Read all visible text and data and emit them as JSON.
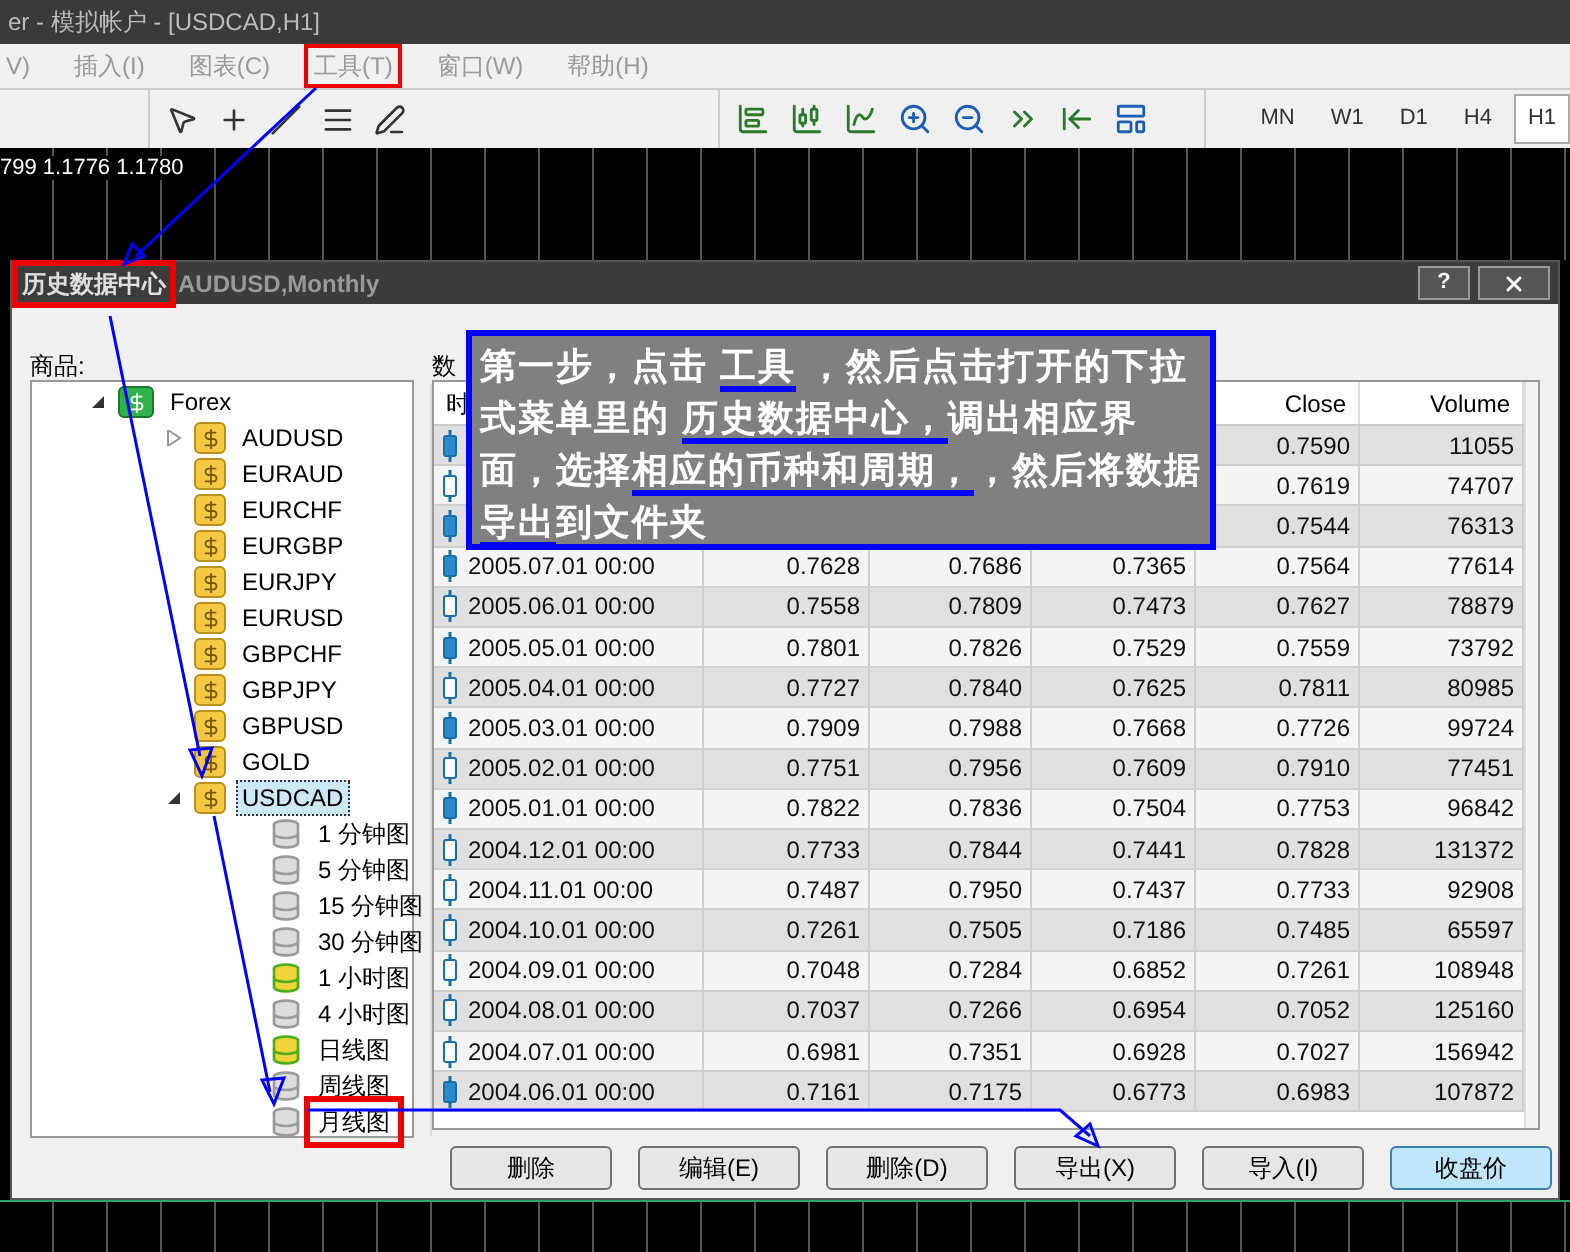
{
  "app_title": "er - 模拟帐户 - [USDCAD,H1]",
  "menu": [
    {
      "label": "V)",
      "highlighted": false
    },
    {
      "label": "插入(I)",
      "highlighted": false
    },
    {
      "label": "图表(C)",
      "highlighted": false
    },
    {
      "label": "工具(T)",
      "highlighted": true
    },
    {
      "label": "窗口(W)",
      "highlighted": false
    },
    {
      "label": "帮助(H)",
      "highlighted": false
    }
  ],
  "timeframes": [
    {
      "label": "MN",
      "selected": false
    },
    {
      "label": "W1",
      "selected": false
    },
    {
      "label": "D1",
      "selected": false
    },
    {
      "label": "H4",
      "selected": false
    },
    {
      "label": "H1",
      "selected": true
    }
  ],
  "chart_strip": "799 1.1776 1.1780",
  "dialog": {
    "title": "历史数据中心",
    "subtitle": "AUDUSD,Monthly",
    "title_highlighted": true,
    "help_button": "?",
    "symbols_label": "商品:",
    "data_label": "数",
    "tree": [
      {
        "label": "Forex",
        "kind": "folder",
        "expanded": true,
        "selected": false,
        "children": [
          {
            "label": "AUDUSD",
            "kind": "symbol",
            "expanded": false,
            "selected": false
          },
          {
            "label": "EURAUD",
            "kind": "symbol",
            "selected": false
          },
          {
            "label": "EURCHF",
            "kind": "symbol",
            "selected": false
          },
          {
            "label": "EURGBP",
            "kind": "symbol",
            "selected": false
          },
          {
            "label": "EURJPY",
            "kind": "symbol",
            "selected": false
          },
          {
            "label": "EURUSD",
            "kind": "symbol",
            "selected": false
          },
          {
            "label": "GBPCHF",
            "kind": "symbol",
            "selected": false
          },
          {
            "label": "GBPJPY",
            "kind": "symbol",
            "selected": false
          },
          {
            "label": "GBPUSD",
            "kind": "symbol",
            "selected": false
          },
          {
            "label": "GOLD",
            "kind": "symbol",
            "selected": false
          },
          {
            "label": "USDCAD",
            "kind": "symbol",
            "expanded": true,
            "selected": true,
            "children": [
              {
                "label": "1 分钟图",
                "kind": "timeframe",
                "has_data": false,
                "selected": false,
                "highlighted": false
              },
              {
                "label": "5 分钟图",
                "kind": "timeframe",
                "has_data": false,
                "selected": false,
                "highlighted": false
              },
              {
                "label": "15 分钟图",
                "kind": "timeframe",
                "has_data": false,
                "selected": false,
                "highlighted": false
              },
              {
                "label": "30 分钟图",
                "kind": "timeframe",
                "has_data": false,
                "selected": false,
                "highlighted": false
              },
              {
                "label": "1 小时图",
                "kind": "timeframe",
                "has_data": true,
                "selected": false,
                "highlighted": false
              },
              {
                "label": "4 小时图",
                "kind": "timeframe",
                "has_data": false,
                "selected": false,
                "highlighted": false
              },
              {
                "label": "日线图",
                "kind": "timeframe",
                "has_data": true,
                "selected": false,
                "highlighted": false
              },
              {
                "label": "周线图",
                "kind": "timeframe",
                "has_data": false,
                "selected": false,
                "highlighted": false
              },
              {
                "label": "月线图",
                "kind": "timeframe",
                "has_data": false,
                "selected": false,
                "highlighted": true
              }
            ]
          }
        ]
      }
    ],
    "table": {
      "columns": [
        "时",
        null,
        null,
        null,
        "Close",
        "Volume"
      ],
      "rows": [
        {
          "filled": true,
          "cells": [
            null,
            null,
            null,
            null,
            "0.7590",
            "11055"
          ]
        },
        {
          "filled": false,
          "cells": [
            null,
            null,
            null,
            null,
            "0.7619",
            "74707"
          ]
        },
        {
          "filled": true,
          "cells": [
            null,
            null,
            null,
            null,
            "0.7544",
            "76313"
          ]
        },
        {
          "filled": true,
          "cells": [
            "2005.07.01 00:00",
            "0.7628",
            "0.7686",
            "0.7365",
            "0.7564",
            "77614"
          ]
        },
        {
          "filled": false,
          "cells": [
            "2005.06.01 00:00",
            "0.7558",
            "0.7809",
            "0.7473",
            "0.7627",
            "78879"
          ]
        },
        {
          "filled": true,
          "cells": [
            "2005.05.01 00:00",
            "0.7801",
            "0.7826",
            "0.7529",
            "0.7559",
            "73792"
          ]
        },
        {
          "filled": false,
          "cells": [
            "2005.04.01 00:00",
            "0.7727",
            "0.7840",
            "0.7625",
            "0.7811",
            "80985"
          ]
        },
        {
          "filled": true,
          "cells": [
            "2005.03.01 00:00",
            "0.7909",
            "0.7988",
            "0.7668",
            "0.7726",
            "99724"
          ]
        },
        {
          "filled": false,
          "cells": [
            "2005.02.01 00:00",
            "0.7751",
            "0.7956",
            "0.7609",
            "0.7910",
            "77451"
          ]
        },
        {
          "filled": true,
          "cells": [
            "2005.01.01 00:00",
            "0.7822",
            "0.7836",
            "0.7504",
            "0.7753",
            "96842"
          ]
        },
        {
          "filled": false,
          "cells": [
            "2004.12.01 00:00",
            "0.7733",
            "0.7844",
            "0.7441",
            "0.7828",
            "131372"
          ]
        },
        {
          "filled": false,
          "cells": [
            "2004.11.01 00:00",
            "0.7487",
            "0.7950",
            "0.7437",
            "0.7733",
            "92908"
          ]
        },
        {
          "filled": false,
          "cells": [
            "2004.10.01 00:00",
            "0.7261",
            "0.7505",
            "0.7186",
            "0.7485",
            "65597"
          ]
        },
        {
          "filled": false,
          "cells": [
            "2004.09.01 00:00",
            "0.7048",
            "0.7284",
            "0.6852",
            "0.7261",
            "108948"
          ]
        },
        {
          "filled": false,
          "cells": [
            "2004.08.01 00:00",
            "0.7037",
            "0.7266",
            "0.6954",
            "0.7052",
            "125160"
          ]
        },
        {
          "filled": false,
          "cells": [
            "2004.07.01 00:00",
            "0.6981",
            "0.7351",
            "0.6928",
            "0.7027",
            "156942"
          ]
        },
        {
          "filled": true,
          "cells": [
            "2004.06.01 00:00",
            "0.7161",
            "0.7175",
            "0.6773",
            "0.6983",
            "107872"
          ]
        }
      ]
    },
    "buttons": [
      {
        "label": "删除",
        "hovered": false
      },
      {
        "label": "编辑(E)",
        "hovered": false
      },
      {
        "label": "删除(D)",
        "hovered": false
      },
      {
        "label": "导出(X)",
        "hovered": false
      },
      {
        "label": "导入(I)",
        "hovered": false
      },
      {
        "label": "收盘价",
        "hovered": true
      }
    ]
  },
  "annotation": [
    {
      "text": "第一步，点击 ",
      "underlined": false
    },
    {
      "text": "工具",
      "underlined": true
    },
    {
      "text": " ，然后点击打开的下拉式菜单里的 ",
      "underlined": false
    },
    {
      "text": "历史数据中心，",
      "underlined": true
    },
    {
      "text": "调出相应界面，选择",
      "underlined": false
    },
    {
      "text": "相应的币种和周期，",
      "underlined": true
    },
    {
      "text": "，然后将数据",
      "underlined": false
    },
    {
      "text": "导出",
      "underlined": true
    },
    {
      "text": "到文件夹",
      "underlined": false
    }
  ]
}
